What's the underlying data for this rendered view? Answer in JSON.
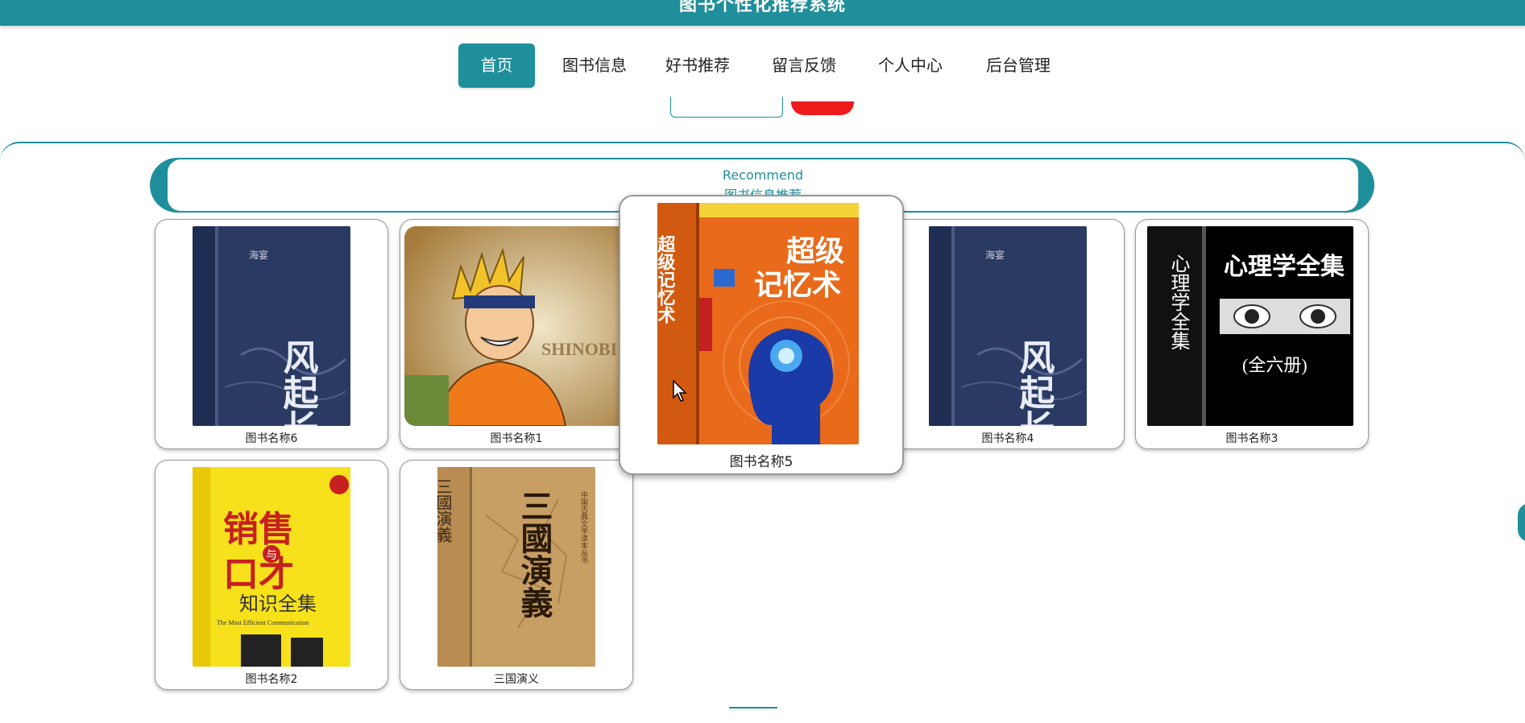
{
  "app": {
    "title": "图书个性化推荐系统"
  },
  "nav": {
    "items": [
      {
        "label": "首页",
        "active": true
      },
      {
        "label": "图书信息"
      },
      {
        "label": "好书推荐"
      },
      {
        "label": "留言反馈"
      },
      {
        "label": "个人中心"
      },
      {
        "label": "后台管理"
      }
    ]
  },
  "recommend": {
    "title_en": "Recommend",
    "title_zh": "图书信息推荐"
  },
  "books": [
    {
      "name": "图书名称6",
      "cover": "wind-forest-cover"
    },
    {
      "name": "图书名称1",
      "cover": "naruto-cover"
    },
    {
      "name": "图书名称5",
      "cover": "memory-cover",
      "hovered": true
    },
    {
      "name": "图书名称4",
      "cover": "wind-forest-cover"
    },
    {
      "name": "图书名称3",
      "cover": "psychology-cover"
    },
    {
      "name": "图书名称2",
      "cover": "sales-cover"
    },
    {
      "name": "三国演义",
      "cover": "three-kingdoms-cover"
    }
  ],
  "cover_text": {
    "wind_title": "风起长林",
    "wind_author": "海宴",
    "naruto_word": "SHINOBI",
    "memory_title_a": "超级",
    "memory_title_b": "记忆术",
    "memory_spine": "超级记忆术",
    "psych_title": "心理学全集",
    "psych_sub": "(全六册)",
    "sales_title_a": "销售",
    "sales_mid": "与",
    "sales_title_b": "口才",
    "sales_sub": "知识全集",
    "sales_en": "The Most Efficient Communication",
    "sanguo_title": "三國演義",
    "sanguo_spine": "中国古典文学读本丛书"
  },
  "colors": {
    "primary": "#1f8f9c",
    "accent_red": "#ee1b1b"
  }
}
